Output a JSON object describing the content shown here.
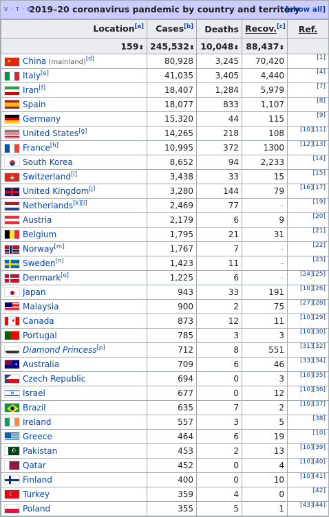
{
  "header": {
    "vte": "V · T · E",
    "title": "2019–20 coronavirus pandemic by country and territory",
    "show_all": "[show all]"
  },
  "columns": {
    "location": "Location",
    "location_note": "[a]",
    "cases": "Cases",
    "cases_note": "[b]",
    "deaths": "Deaths",
    "recov": "Recov.",
    "recov_note": "[c]",
    "ref": "Ref."
  },
  "totals": {
    "countries": "159",
    "cases": "245,532",
    "deaths": "10,048",
    "recov": "88,437"
  },
  "rows": [
    {
      "country": "China",
      "sub": " (mainland)",
      "note": "[d]",
      "cases": "80,928",
      "deaths": "3,245",
      "recov": "70,420",
      "ref": "[1]",
      "flag": "china"
    },
    {
      "country": "Italy",
      "sub": "",
      "note": "[e]",
      "cases": "41,035",
      "deaths": "3,405",
      "recov": "4,440",
      "ref": "[4]",
      "flag": "italy"
    },
    {
      "country": "Iran",
      "sub": "",
      "note": "[f]",
      "cases": "18,407",
      "deaths": "1,284",
      "recov": "5,979",
      "ref": "[7]",
      "flag": "iran"
    },
    {
      "country": "Spain",
      "sub": "",
      "note": "",
      "cases": "18,077",
      "deaths": "833",
      "recov": "1,107",
      "ref": "[8]",
      "flag": "spain"
    },
    {
      "country": "Germany",
      "sub": "",
      "note": "",
      "cases": "15,320",
      "deaths": "44",
      "recov": "115",
      "ref": "[9]",
      "flag": "germany"
    },
    {
      "country": "United States",
      "sub": "",
      "note": "[g]",
      "cases": "14,265",
      "deaths": "218",
      "recov": "108",
      "ref": "[10][11]",
      "flag": "usa"
    },
    {
      "country": "France",
      "sub": "",
      "note": "[h]",
      "cases": "10,995",
      "deaths": "372",
      "recov": "1300",
      "ref": "[12][13]",
      "flag": "france"
    },
    {
      "country": "South Korea",
      "sub": "",
      "note": "",
      "cases": "8,652",
      "deaths": "94",
      "recov": "2,233",
      "ref": "[14]",
      "flag": "korea"
    },
    {
      "country": "Switzerland",
      "sub": "",
      "note": "[i]",
      "cases": "3,438",
      "deaths": "33",
      "recov": "15",
      "ref": "[15]",
      "flag": "swiss"
    },
    {
      "country": "United Kingdom",
      "sub": "",
      "note": "[j]",
      "cases": "3,280",
      "deaths": "144",
      "recov": "79",
      "ref": "[16][17]",
      "flag": "uk"
    },
    {
      "country": "Netherlands",
      "sub": "",
      "note": "[k][l]",
      "cases": "2,469",
      "deaths": "77",
      "recov": "–",
      "ref": "[19]",
      "flag": "netherlands"
    },
    {
      "country": "Austria",
      "sub": "",
      "note": "",
      "cases": "2,179",
      "deaths": "6",
      "recov": "9",
      "ref": "[20]",
      "flag": "austria"
    },
    {
      "country": "Belgium",
      "sub": "",
      "note": "",
      "cases": "1,795",
      "deaths": "21",
      "recov": "31",
      "ref": "[21]",
      "flag": "belgium"
    },
    {
      "country": "Norway",
      "sub": "",
      "note": "[m]",
      "cases": "1,767",
      "deaths": "7",
      "recov": "–",
      "ref": "[22]",
      "flag": "norway"
    },
    {
      "country": "Sweden",
      "sub": "",
      "note": "[n]",
      "cases": "1,423",
      "deaths": "11",
      "recov": "–",
      "ref": "[23]",
      "flag": "sweden"
    },
    {
      "country": "Denmark",
      "sub": "",
      "note": "[o]",
      "cases": "1,225",
      "deaths": "6",
      "recov": "–",
      "ref": "[24][25]",
      "flag": "denmark"
    },
    {
      "country": "Japan",
      "sub": "",
      "note": "",
      "cases": "943",
      "deaths": "33",
      "recov": "191",
      "ref": "[10][26]",
      "flag": "japan"
    },
    {
      "country": "Malaysia",
      "sub": "",
      "note": "",
      "cases": "900",
      "deaths": "2",
      "recov": "75",
      "ref": "[27][28]",
      "flag": "malaysia"
    },
    {
      "country": "Canada",
      "sub": "",
      "note": "",
      "cases": "873",
      "deaths": "12",
      "recov": "11",
      "ref": "[10][29]",
      "flag": "canada"
    },
    {
      "country": "Portugal",
      "sub": "",
      "note": "",
      "cases": "785",
      "deaths": "3",
      "recov": "3",
      "ref": "[10][30]",
      "flag": "portugal"
    },
    {
      "country": "Diamond Princess",
      "sub": "",
      "note": "[p]",
      "cases": "712",
      "deaths": "8",
      "recov": "551",
      "ref": "[31][32]",
      "flag": "ship",
      "italic": true
    },
    {
      "country": "Australia",
      "sub": "",
      "note": "",
      "cases": "709",
      "deaths": "6",
      "recov": "46",
      "ref": "[33][34]",
      "flag": "australia"
    },
    {
      "country": "Czech Republic",
      "sub": "",
      "note": "",
      "cases": "694",
      "deaths": "0",
      "recov": "3",
      "ref": "[10][35]",
      "flag": "czech"
    },
    {
      "country": "Israel",
      "sub": "",
      "note": "",
      "cases": "677",
      "deaths": "0",
      "recov": "12",
      "ref": "[10][36]",
      "flag": "israel"
    },
    {
      "country": "Brazil",
      "sub": "",
      "note": "",
      "cases": "635",
      "deaths": "7",
      "recov": "2",
      "ref": "[10][37]",
      "flag": "brazil"
    },
    {
      "country": "Ireland",
      "sub": "",
      "note": "",
      "cases": "557",
      "deaths": "3",
      "recov": "5",
      "ref": "[38]",
      "flag": "ireland"
    },
    {
      "country": "Greece",
      "sub": "",
      "note": "",
      "cases": "464",
      "deaths": "6",
      "recov": "19",
      "ref": "[10]",
      "flag": "greece"
    },
    {
      "country": "Pakistan",
      "sub": "",
      "note": "",
      "cases": "453",
      "deaths": "2",
      "recov": "13",
      "ref": "[10][39]",
      "flag": "pakistan"
    },
    {
      "country": "Qatar",
      "sub": "",
      "note": "",
      "cases": "452",
      "deaths": "0",
      "recov": "4",
      "ref": "[10][40]",
      "flag": "qatar"
    },
    {
      "country": "Finland",
      "sub": "",
      "note": "",
      "cases": "400",
      "deaths": "0",
      "recov": "10",
      "ref": "[10][41]",
      "flag": "finland"
    },
    {
      "country": "Turkey",
      "sub": "",
      "note": "",
      "cases": "359",
      "deaths": "4",
      "recov": "0",
      "ref": "[42]",
      "flag": "turkey"
    },
    {
      "country": "Poland",
      "sub": "",
      "note": "",
      "cases": "355",
      "deaths": "5",
      "recov": "1",
      "ref": "[43][44]",
      "flag": "poland"
    }
  ],
  "colors": {
    "header_bg": "#ccccff",
    "th_bg": "#eaecf0",
    "link": "#0645ad",
    "border": "#a2a9b1"
  }
}
